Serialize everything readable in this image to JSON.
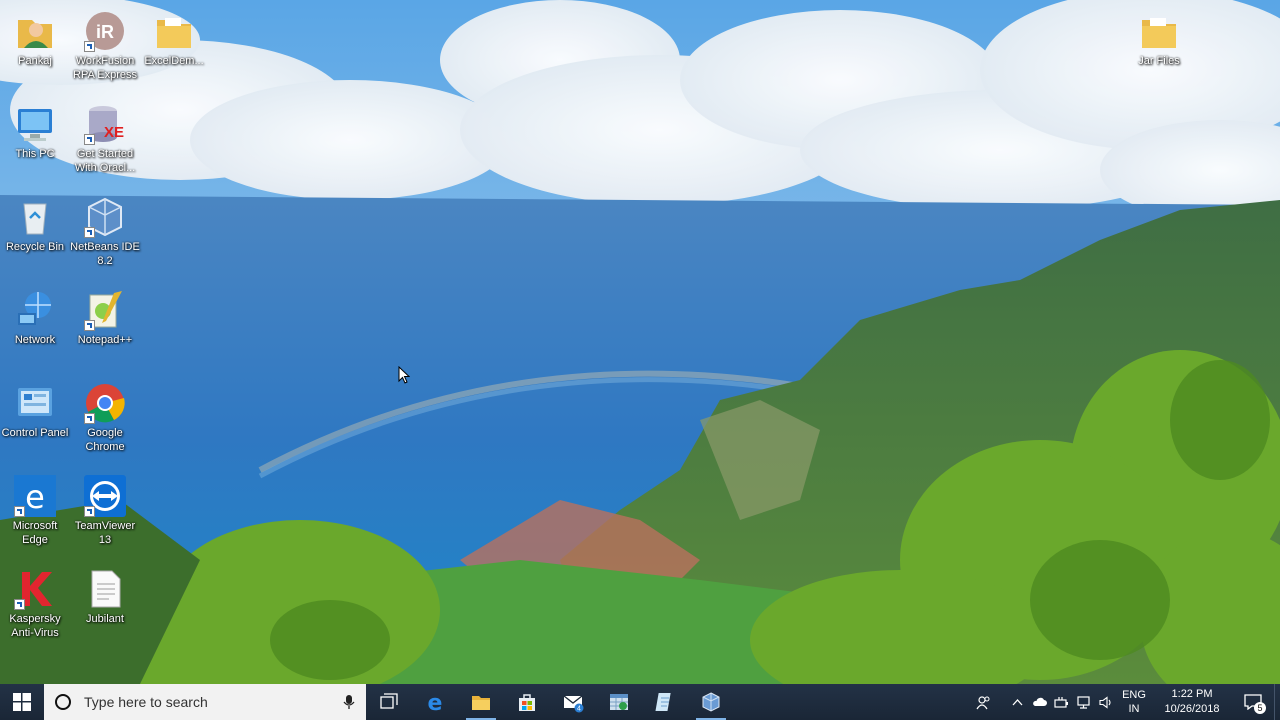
{
  "desktop": {
    "icons": [
      {
        "label": "Pankaj",
        "icon": "user-folder-icon"
      },
      {
        "label": "WorkFusion RPA Express",
        "icon": "workfusion-icon"
      },
      {
        "label": "ExcelDem...",
        "icon": "folder-icon"
      },
      {
        "label": "This PC",
        "icon": "computer-icon"
      },
      {
        "label": "Get Started With Oracl...",
        "icon": "oracle-database-icon"
      },
      {
        "label": "Recycle Bin",
        "icon": "recycle-bin-icon"
      },
      {
        "label": "NetBeans IDE 8.2",
        "icon": "netbeans-icon"
      },
      {
        "label": "Network",
        "icon": "network-icon"
      },
      {
        "label": "Notepad++",
        "icon": "notepad-plus-plus-icon"
      },
      {
        "label": "Control Panel",
        "icon": "control-panel-icon"
      },
      {
        "label": "Google Chrome",
        "icon": "chrome-icon"
      },
      {
        "label": "Microsoft Edge",
        "icon": "edge-icon"
      },
      {
        "label": "TeamViewer 13",
        "icon": "teamviewer-icon"
      },
      {
        "label": "Kaspersky Anti-Virus",
        "icon": "kaspersky-icon"
      },
      {
        "label": "Jubilant",
        "icon": "text-document-icon"
      },
      {
        "label": "Jar Files",
        "icon": "folder-icon"
      }
    ]
  },
  "taskbar": {
    "search_placeholder": "Type here to search",
    "apps": [
      {
        "name": "task-view-icon"
      },
      {
        "name": "edge-icon"
      },
      {
        "name": "file-explorer-icon"
      },
      {
        "name": "store-icon"
      },
      {
        "name": "mail-icon",
        "badge": "4"
      },
      {
        "name": "spreadsheet-app-icon"
      },
      {
        "name": "notepad-icon"
      },
      {
        "name": "netbeans-icon"
      }
    ],
    "tray": {
      "language_line1": "ENG",
      "language_line2": "IN",
      "time": "1:22 PM",
      "date": "10/26/2018",
      "notification_count": "5"
    }
  },
  "colors": {
    "taskbar": "#1b2838",
    "search_box": "#f2f2f2",
    "accent": "#0078d7"
  }
}
